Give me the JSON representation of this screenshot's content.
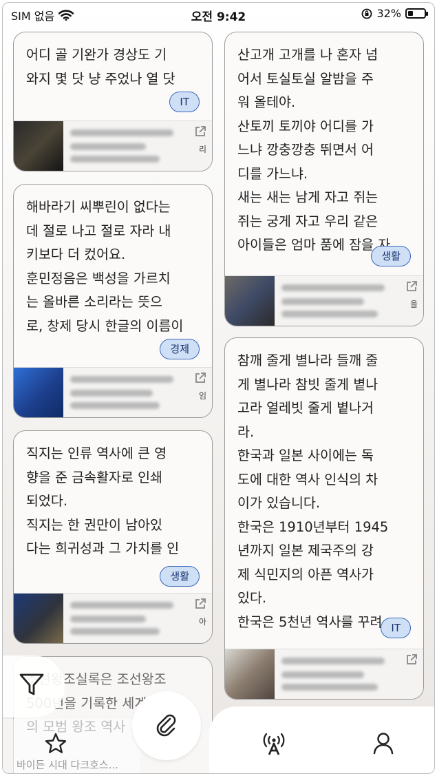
{
  "status": {
    "carrier": "SIM 없음",
    "time": "오전 9:42",
    "battery": "32%",
    "battery_level": 0.32
  },
  "cards": [
    {
      "text": "어디 골 기완가 경상도 기\n와지 몇 닷 냥 주었나 열 닷",
      "badge": "IT"
    },
    {
      "text": "산고개 고개를 나 혼자 넘\n어서 토실토실 알밤을 주\n워 올테야.\n산토끼 토끼야 어디를 가\n느냐 깡충깡충 뛰면서 어\n디를 가느냐.\n새는 새는 남게 자고 쥐는\n쥐는 궁게 자고 우리 같은\n아이들은 엄마 품에 잠을 자",
      "badge": "생활"
    },
    {
      "text": "해바라기 씨뿌린이 없다는\n데 절로 나고 절로 자라 내\n키보다 더 컸어요.\n훈민정음은 백성을 가르치\n는 올바른 소리라는 뜻으\n로, 창제 당시 한글의 이름이",
      "badge": "경제"
    },
    {
      "text": "참깨 줄게 별나라 들깨 줄\n게 별나라 참빗 줄게 볕나\n고라 열레빗 줄게 볕나거\n라.\n한국과 일본 사이에는 독\n도에 대한 역사 인식의 차\n이가 있습니다.\n한국은 1910년부터 1945\n년까지 일본 제국주의 강\n제 식민지의 아픈 역사가\n있다.\n한국은 5천년 역사를 꾸려",
      "badge": "IT"
    },
    {
      "text": "직지는 인류 역사에 큰 영\n향을 준 금속활자로 인쇄\n되었다.\n직지는 한 권만이 남아있\n다는 희귀성과 그 가치를 인",
      "badge": "생활"
    },
    {
      "text": "조선왕조실록은 조선왕조\n500년을 기록한 세계\n의 모범 왕조 역사",
      "badge": ""
    }
  ],
  "preview_peeks": [
    "리",
    "임",
    "을",
    "아"
  ],
  "footer_peek": "바이든 시대 다크호스...",
  "icons": {
    "filter": "filter-icon",
    "favorites": "star-icon",
    "attach": "paperclip-icon",
    "broadcast": "antenna-icon",
    "profile": "person-icon"
  },
  "colors": {
    "badge_bg": "#cfe0f6",
    "badge_border": "#3a67b8"
  }
}
